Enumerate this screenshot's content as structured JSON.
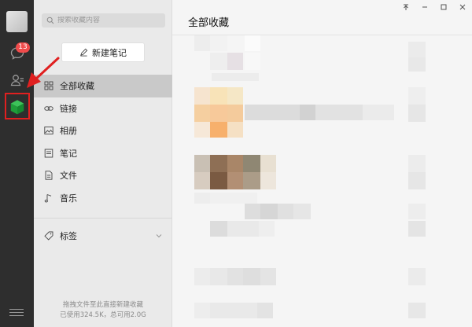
{
  "rail": {
    "chat_badge": "13",
    "colors": {
      "rail_bg": "#2e2e2e",
      "badge": "#f04b4b",
      "favorites_icon": "#1faa3c",
      "annotation": "#e02020"
    }
  },
  "search": {
    "placeholder": "搜索收藏内容"
  },
  "new_note": {
    "label": "新建笔记"
  },
  "nav": {
    "items": [
      {
        "label": "全部收藏",
        "icon": "grid-icon",
        "active": true
      },
      {
        "label": "链接",
        "icon": "link-icon"
      },
      {
        "label": "相册",
        "icon": "image-icon"
      },
      {
        "label": "笔记",
        "icon": "note-icon"
      },
      {
        "label": "文件",
        "icon": "file-icon"
      },
      {
        "label": "音乐",
        "icon": "music-icon"
      }
    ],
    "tags_label": "标签"
  },
  "footer": {
    "line1": "拖拽文件至此直接新建收藏",
    "line2": "已使用324.5K，总可用2.0G"
  },
  "main": {
    "title": "全部收藏"
  },
  "window_controls": {
    "pin": "pin-icon",
    "minimize": "minimize-icon",
    "maximize": "maximize-icon",
    "close": "close-icon"
  }
}
